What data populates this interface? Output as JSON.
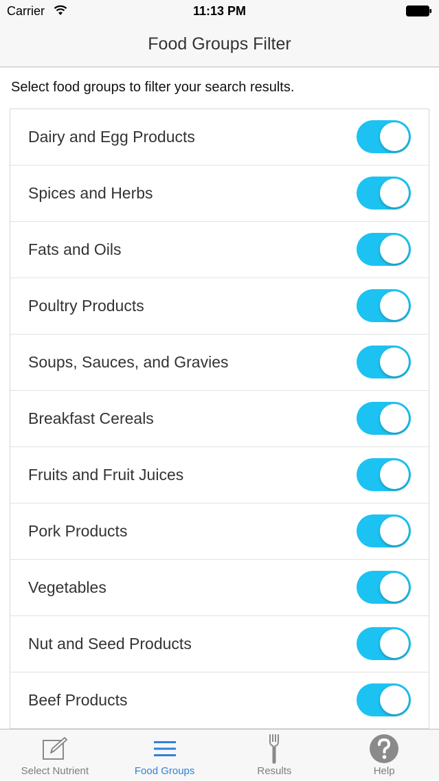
{
  "status_bar": {
    "carrier": "Carrier",
    "time": "11:13 PM",
    "wifi_icon": "wifi-icon",
    "battery_icon": "battery-icon"
  },
  "nav": {
    "title": "Food Groups Filter"
  },
  "instructions": "Select food groups to filter your search results.",
  "colors": {
    "toggle_on": "#1cc3f2",
    "tab_active": "#2f80d8",
    "tab_inactive": "#7d7d7d"
  },
  "food_groups": [
    {
      "label": "Dairy and Egg Products",
      "enabled": true
    },
    {
      "label": "Spices and Herbs",
      "enabled": true
    },
    {
      "label": "Fats and Oils",
      "enabled": true
    },
    {
      "label": "Poultry Products",
      "enabled": true
    },
    {
      "label": "Soups, Sauces, and Gravies",
      "enabled": true
    },
    {
      "label": "Breakfast Cereals",
      "enabled": true
    },
    {
      "label": "Fruits and Fruit Juices",
      "enabled": true
    },
    {
      "label": "Pork Products",
      "enabled": true
    },
    {
      "label": "Vegetables",
      "enabled": true
    },
    {
      "label": "Nut and Seed Products",
      "enabled": true
    },
    {
      "label": "Beef Products",
      "enabled": true
    }
  ],
  "tabs": [
    {
      "label": "Select Nutrient",
      "icon": "edit-icon",
      "active": false
    },
    {
      "label": "Food Groups",
      "icon": "list-icon",
      "active": true
    },
    {
      "label": "Results",
      "icon": "fork-icon",
      "active": false
    },
    {
      "label": "Help",
      "icon": "help-icon",
      "active": false
    }
  ]
}
